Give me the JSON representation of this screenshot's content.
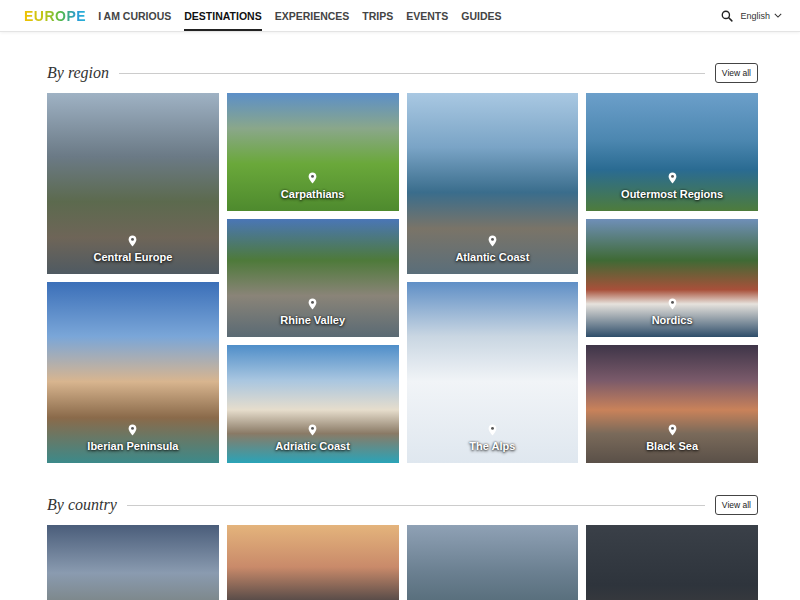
{
  "header": {
    "logo": "EUROPE",
    "nav": [
      {
        "label": "I AM CURIOUS",
        "selected": false
      },
      {
        "label": "DESTINATIONS",
        "selected": true
      },
      {
        "label": "EXPERIENCES",
        "selected": false
      },
      {
        "label": "TRIPS",
        "selected": false
      },
      {
        "label": "EVENTS",
        "selected": false
      },
      {
        "label": "GUIDES",
        "selected": false
      }
    ],
    "language": "English"
  },
  "by_region": {
    "title": "By region",
    "button": "View all",
    "cards": [
      {
        "name": "Central Europe",
        "kind": "tall"
      },
      {
        "name": "Iberian Peninsula",
        "kind": "tall"
      },
      {
        "name": "Carpathians",
        "kind": "short"
      },
      {
        "name": "Rhine Valley",
        "kind": "short"
      },
      {
        "name": "Adriatic Coast",
        "kind": "short"
      },
      {
        "name": "Atlantic Coast",
        "kind": "tall"
      },
      {
        "name": "The Alps",
        "kind": "tall"
      },
      {
        "name": "Outermost Regions",
        "kind": "short"
      },
      {
        "name": "Nordics",
        "kind": "short"
      },
      {
        "name": "Black Sea",
        "kind": "short"
      }
    ]
  },
  "by_country": {
    "title": "By country",
    "button": "View all",
    "cards": [
      {
        "kind": "photo"
      },
      {
        "kind": "photo"
      },
      {
        "kind": "photo"
      },
      {
        "kind": "photo"
      }
    ]
  }
}
